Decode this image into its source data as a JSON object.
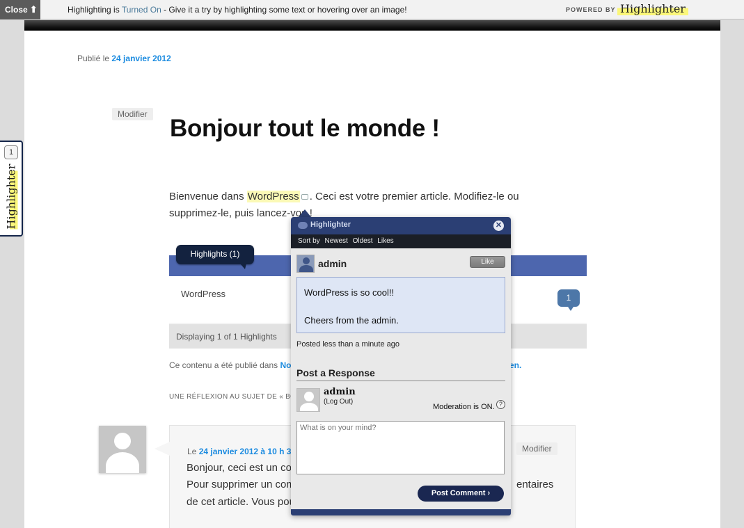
{
  "topbar": {
    "close_label": "Close",
    "close_icon": "arrow-up-icon",
    "message_prefix": "Highlighting is ",
    "status": "Turned On",
    "message_suffix": " - Give it a try by highlighting some text or hovering over an image!",
    "powered_by": "POWERED BY",
    "logo_text": "Highlighter"
  },
  "post": {
    "published_prefix": "Publié le ",
    "published_date": "24 janvier 2012",
    "edit_label": "Modifier",
    "title": "Bonjour tout le monde !",
    "body_before": "Bienvenue dans ",
    "body_highlight": "WordPress",
    "body_after": ". Ceci est votre premier article. Modifiez-le ou supprimez-le, puis lancez-vo",
    "body_end": "s !"
  },
  "highlights_widget": {
    "tab_label": "Highlights (1)",
    "row_label": "WordPress",
    "count": "1",
    "footer": "Displaying 1 of 1 Highlights"
  },
  "filed": {
    "text": "Ce contenu a été publié dans ",
    "category_start": "No",
    "tail": "en."
  },
  "reflexion": "UNE RÉFLEXION AU SUJET DE « BO",
  "comment": {
    "meta_prefix": "Le ",
    "date": "24 janvier 2012 à 10 h 3",
    "edit_label": "Modifier",
    "line1": "Bonjour, ceci est un co",
    "line2": "Pour supprimer un com",
    "line2_tail": "entaires",
    "line3": "de cet article. Vous pou"
  },
  "side_tab": {
    "badge": "1",
    "logo_text": "Highlighter"
  },
  "popup": {
    "title": "Highlighter",
    "close_glyph": "✕",
    "sort_label": "Sort by",
    "sort_options": [
      "Newest",
      "Oldest",
      "Likes"
    ],
    "user": "admin",
    "like_label": "Like",
    "comment_line1": "WordPress is so cool!!",
    "comment_line2": "Cheers from the admin.",
    "posted_ago": "Posted less than a minute ago",
    "post_response_heading": "Post a Response",
    "responder_name": "admin",
    "logout_label": "(Log Out)",
    "moderation": "Moderation is ON.",
    "help_glyph": "?",
    "input_placeholder": "What is on your mind?",
    "submit_label": "Post Comment ›"
  },
  "colors": {
    "popup_header": "#2b3f74",
    "sort_bar": "#1b1f27",
    "highlight_yellow": "#fbf9b6",
    "link_blue": "#1b8be0",
    "strip_blue": "#4d66ae"
  }
}
